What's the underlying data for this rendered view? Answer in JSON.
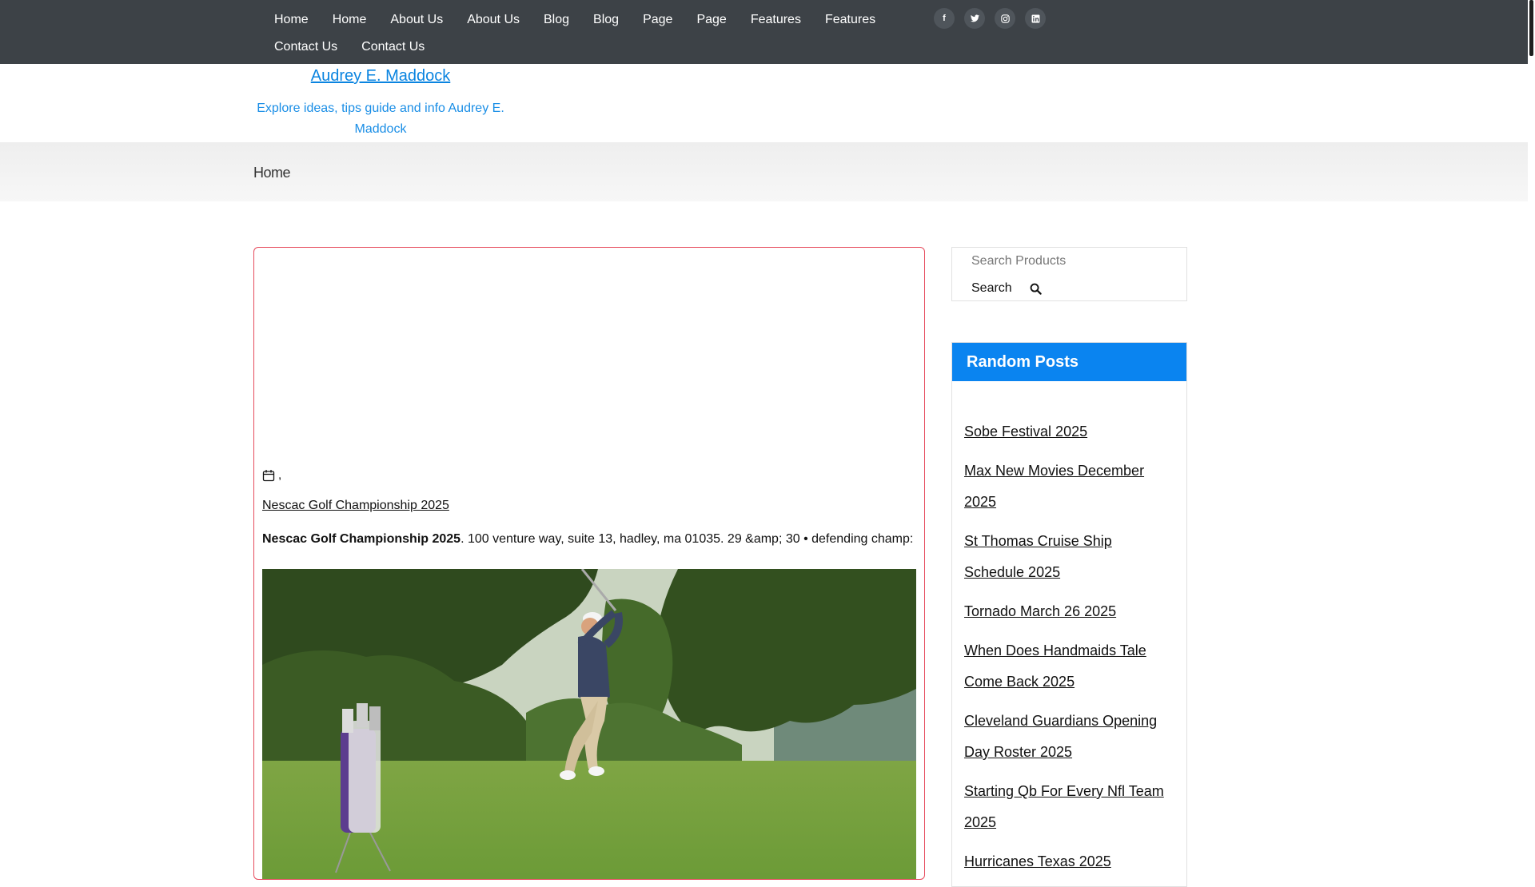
{
  "nav": {
    "items": [
      "Home",
      "Home",
      "About Us",
      "About Us",
      "Blog",
      "Blog",
      "Page",
      "Page",
      "Features",
      "Features",
      "Contact Us",
      "Contact Us"
    ]
  },
  "social": [
    {
      "icon": "facebook-icon",
      "glyph": "f"
    },
    {
      "icon": "twitter-icon",
      "glyph": "t"
    },
    {
      "icon": "instagram-icon",
      "glyph": "◎"
    },
    {
      "icon": "linkedin-icon",
      "glyph": "in"
    }
  ],
  "site": {
    "title": "Audrey E. Maddock",
    "tagline": "Explore ideas, tips guide and info Audrey E. Maddock"
  },
  "breadcrumb": "Home",
  "article": {
    "meta_suffix": ",",
    "title_link": "Nescac Golf Championship 2025",
    "excerpt_bold": "Nescac Golf Championship 2025",
    "excerpt_rest": ". 100 venture way, suite 13, hadley, ma 01035. 29 &amp; 30 • defending champ:"
  },
  "search": {
    "placeholder": "Search Products",
    "button_label": "Search"
  },
  "random_posts": {
    "title": "Random Posts",
    "items": [
      "Sobe Festival 2025",
      "Max New Movies December 2025",
      "St Thomas Cruise Ship Schedule 2025",
      "Tornado March 26 2025",
      "When Does Handmaids Tale Come Back 2025",
      "Cleveland Guardians Opening Day Roster 2025",
      "Starting Qb For Every Nfl Team 2025",
      "Hurricanes Texas 2025"
    ]
  },
  "colors": {
    "topbar": "#3d4247",
    "accent": "#0a84f0",
    "card_border": "#e64a5c"
  }
}
